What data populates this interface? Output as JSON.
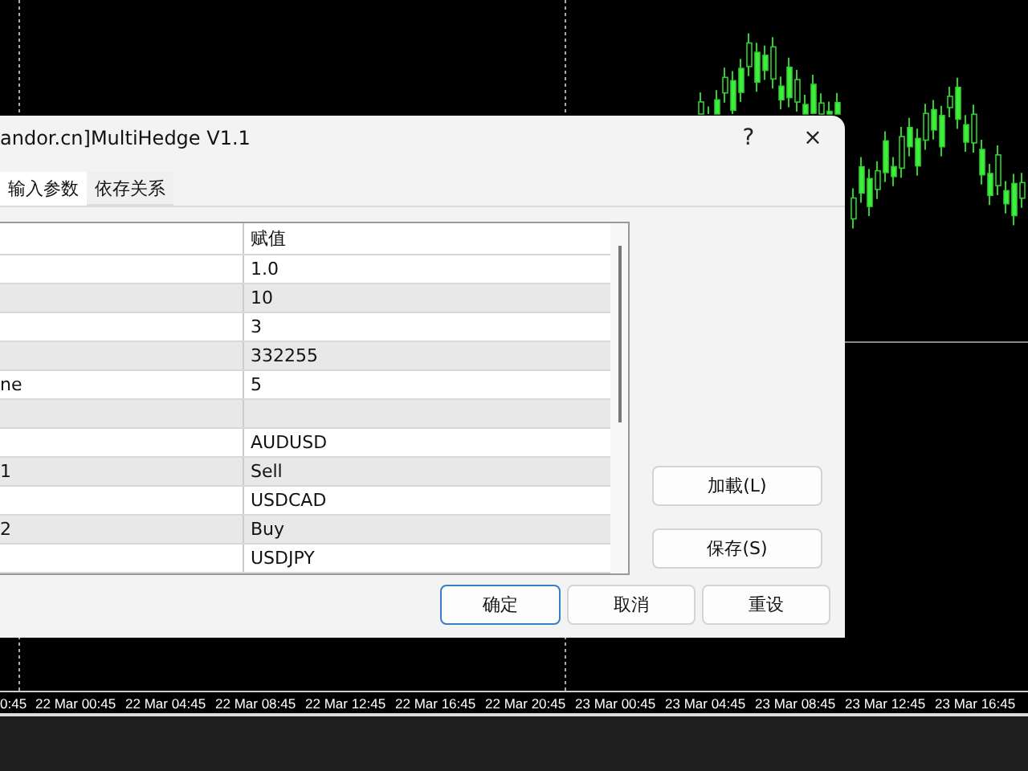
{
  "dialog": {
    "title": "andor.cn]MultiHedge V1.1",
    "help": "?",
    "close": "×",
    "tabs": [
      {
        "label": "输入参数",
        "selected": true
      },
      {
        "label": "依存关系",
        "selected": false
      }
    ],
    "table": {
      "columns": [
        "",
        "赋值"
      ],
      "rows": [
        [
          "",
          "1.0"
        ],
        [
          "",
          "10"
        ],
        [
          "",
          "3"
        ],
        [
          "",
          "332255"
        ],
        [
          "ne",
          "5"
        ],
        [
          "",
          ""
        ],
        [
          "",
          "AUDUSD"
        ],
        [
          "1",
          "Sell"
        ],
        [
          "",
          "USDCAD"
        ],
        [
          "2",
          "Buy"
        ],
        [
          "",
          "USDJPY"
        ]
      ]
    },
    "side_buttons": [
      "加載(L)",
      "保存(S)"
    ],
    "buttons": [
      {
        "label": "确定",
        "selected": true
      },
      {
        "label": "取消",
        "selected": false
      },
      {
        "label": "重设",
        "selected": false
      }
    ]
  },
  "time_axis": [
    "0:45",
    "22 Mar 00:45",
    "22 Mar 04:45",
    "22 Mar 08:45",
    "22 Mar 12:45",
    "22 Mar 16:45",
    "22 Mar 20:45",
    "23 Mar 00:45",
    "23 Mar 04:45",
    "23 Mar 08:45",
    "23 Mar 12:45",
    "23 Mar 16:45"
  ]
}
